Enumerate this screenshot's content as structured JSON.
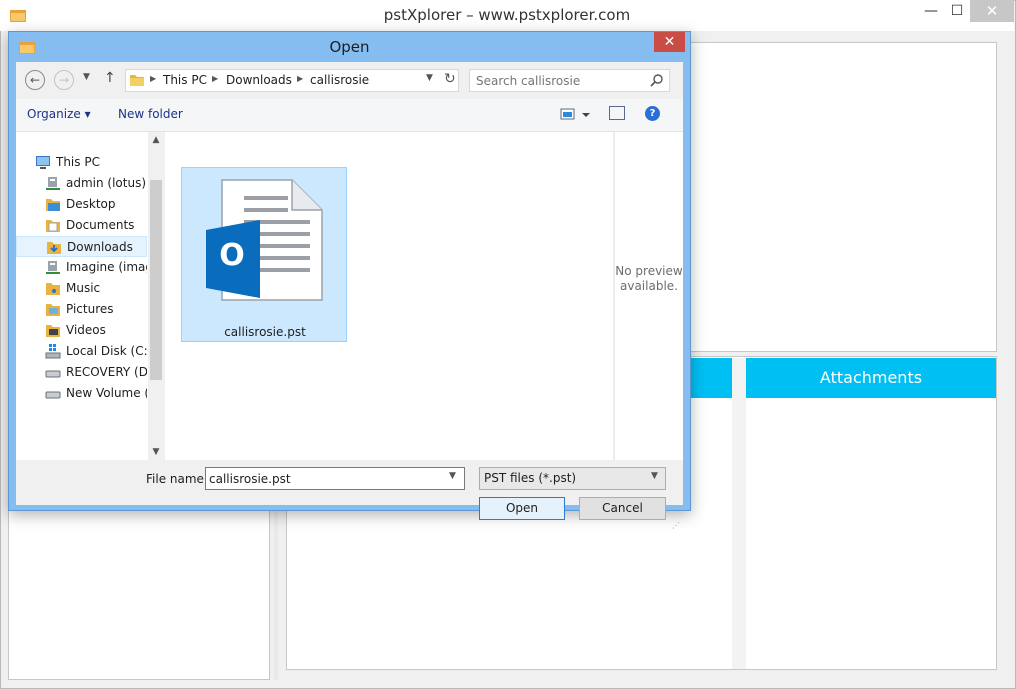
{
  "app": {
    "title": "pstXplorer – www.pstxplorer.com",
    "close_glyph": "✕",
    "min_glyph": "—",
    "max_glyph": "☐",
    "attachments_label": "Attachments"
  },
  "dialog": {
    "title": "Open",
    "close_glyph": "✕",
    "breadcrumbs": [
      "This PC",
      "Downloads",
      "callisrosie"
    ],
    "search_placeholder": "Search callisrosie",
    "toolbar": {
      "organize_label": "Organize ▾",
      "new_folder_label": "New folder",
      "help_glyph": "?"
    },
    "nav_items": [
      {
        "label": "This PC",
        "icon": "computer-icon"
      },
      {
        "label": "admin (lotus)",
        "icon": "network-drive-icon"
      },
      {
        "label": "Desktop",
        "icon": "folder-icon"
      },
      {
        "label": "Documents",
        "icon": "folder-icon"
      },
      {
        "label": "Downloads",
        "icon": "downloads-folder-icon",
        "selected": true
      },
      {
        "label": "Imagine (imagi",
        "icon": "network-drive-icon"
      },
      {
        "label": "Music",
        "icon": "folder-icon"
      },
      {
        "label": "Pictures",
        "icon": "folder-icon"
      },
      {
        "label": "Videos",
        "icon": "folder-icon"
      },
      {
        "label": "Local Disk (C:)",
        "icon": "system-drive-icon"
      },
      {
        "label": "RECOVERY (D:)",
        "icon": "drive-icon"
      },
      {
        "label": "New Volume (H",
        "icon": "drive-icon"
      }
    ],
    "files": [
      {
        "name": "callisrosie.pst",
        "icon": "outlook-pst-icon",
        "icon_letter": "O",
        "selected": true
      }
    ],
    "preview": {
      "line1": "No preview",
      "line2": "available."
    },
    "file_name_label": "File name:",
    "file_name_value": "callisrosie.pst",
    "file_type_value": "PST files (*.pst)",
    "open_label": "Open",
    "cancel_label": "Cancel"
  },
  "colors": {
    "accent": "#00c0f3",
    "dialog_frame": "#86bdf0",
    "close_red": "#c94c45",
    "outlook_blue": "#0a6cbc"
  }
}
